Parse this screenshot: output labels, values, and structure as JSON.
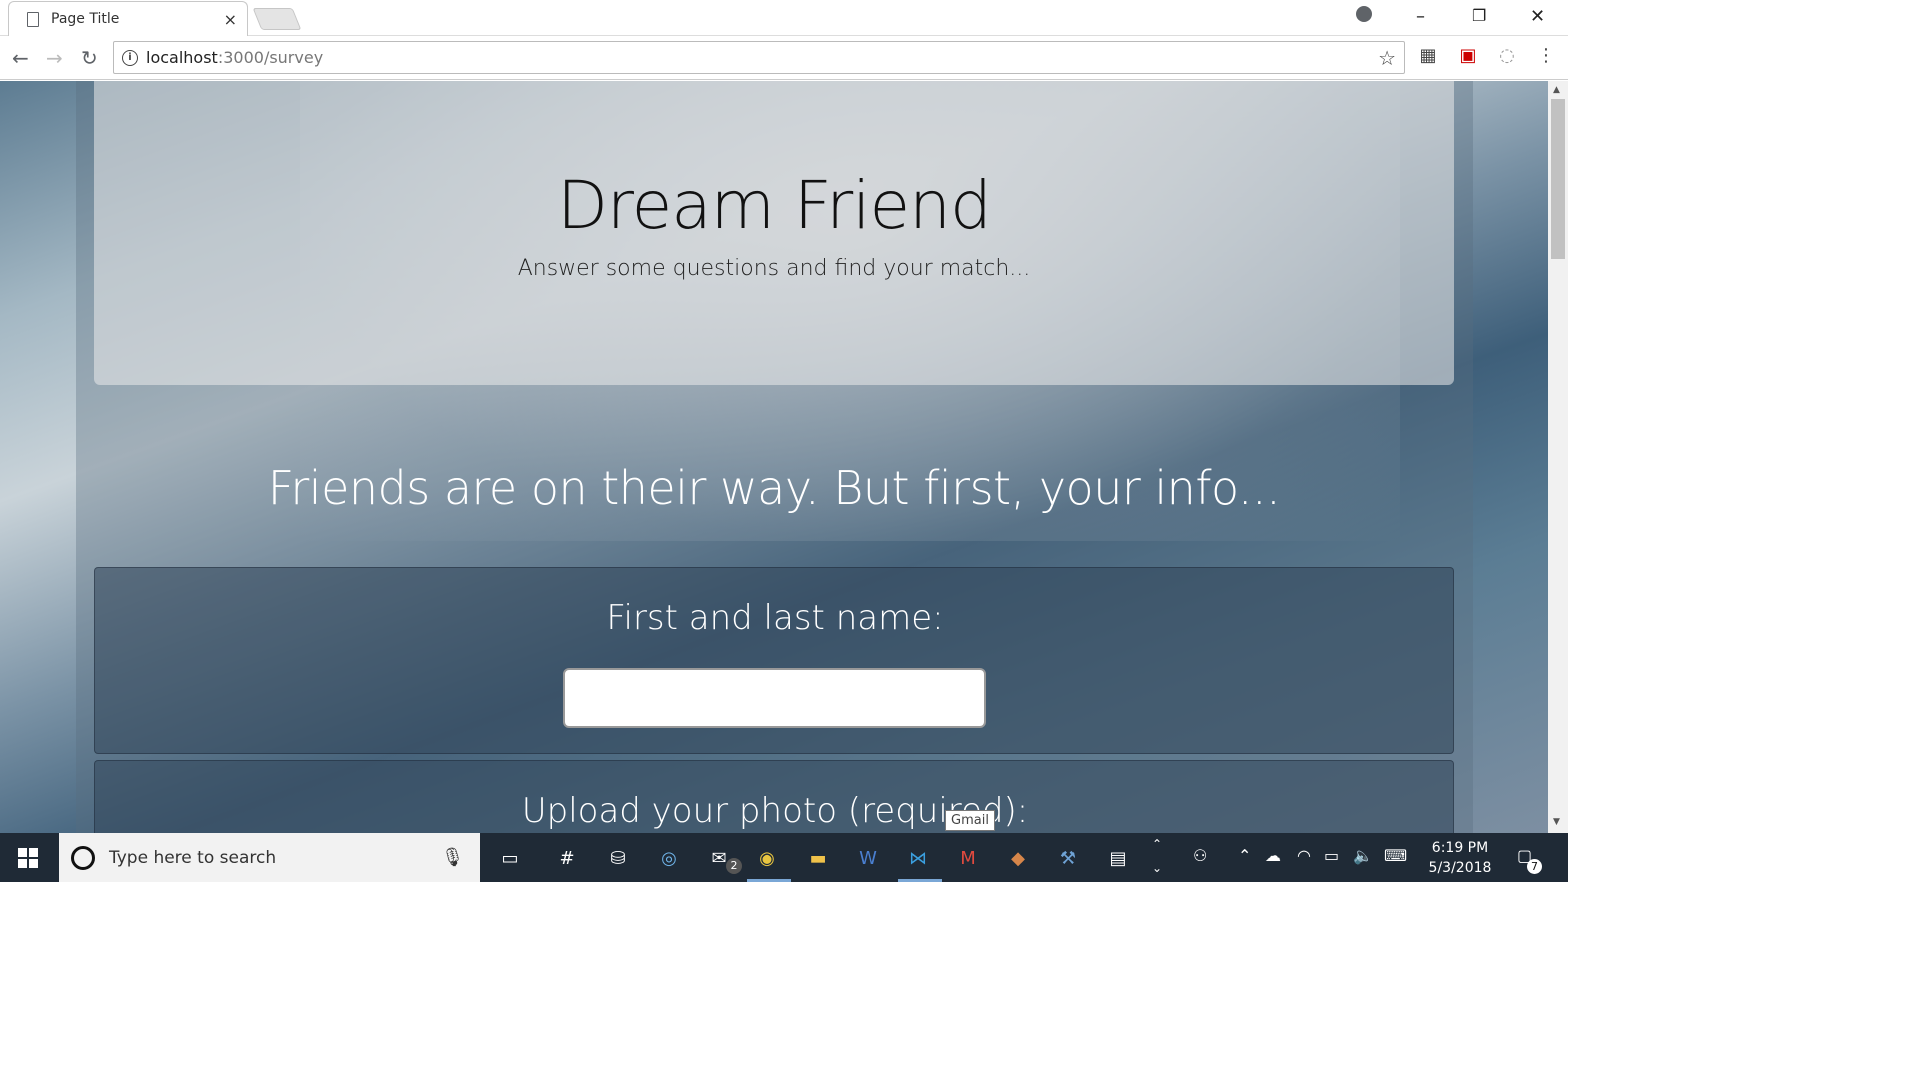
{
  "browser": {
    "tab_title": "Page Title",
    "tab_close": "×",
    "url_host": "localhost",
    "url_rest": ":3000/survey",
    "window_controls": {
      "minimize": "–",
      "restore": "❐",
      "close": "✕"
    },
    "nav": {
      "back": "←",
      "forward": "→",
      "reload": "↻"
    },
    "star": "☆",
    "extensions": [
      "reader-icon",
      "shield-extension-icon",
      "pending-extension-icon"
    ],
    "menu": "⋮"
  },
  "page": {
    "jumbotron": {
      "title": "Dream Friend",
      "subtitle": "Answer some questions and find your match..."
    },
    "section_heading": "Friends are on their way. But first, your info...",
    "name_panel": {
      "label": "First and last name:",
      "value": ""
    },
    "photo_panel": {
      "label": "Upload your photo (required):"
    }
  },
  "tooltip": "Gmail",
  "taskbar": {
    "search_placeholder": "Type here to search",
    "mail_badge": "2",
    "notifications_badge": "7",
    "time": "6:19 PM",
    "date": "5/3/2018",
    "apps": [
      "task-view-icon",
      "slack-icon",
      "store-icon",
      "safari-icon",
      "mail-icon",
      "chrome-icon",
      "file-explorer-icon",
      "word-icon",
      "vscode-icon",
      "gmail-icon",
      "git-icon",
      "mysql-icon",
      "terminal-icon"
    ]
  }
}
